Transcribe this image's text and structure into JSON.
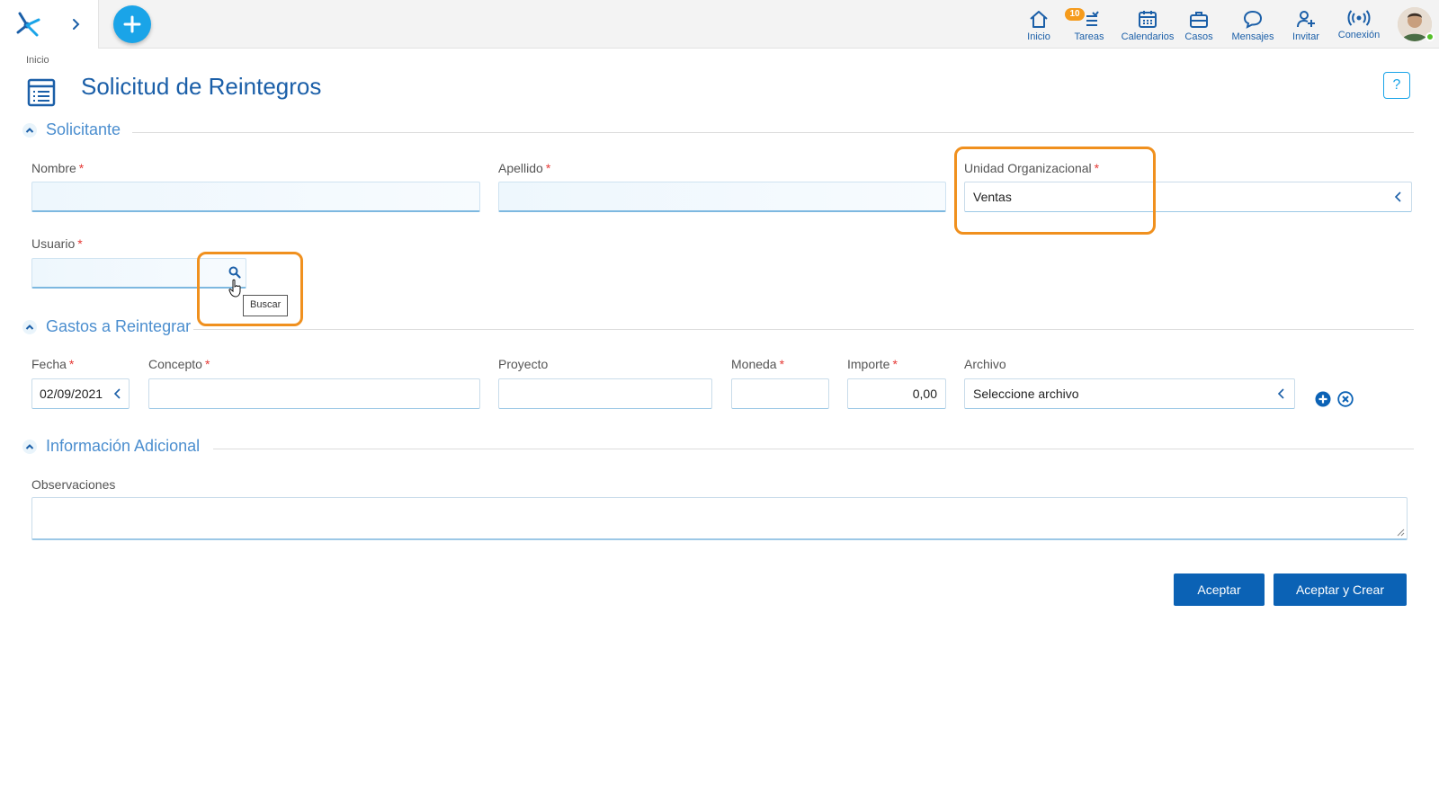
{
  "topbar": {
    "nav": [
      {
        "label": "Inicio",
        "icon": "home-icon"
      },
      {
        "label": "Tareas",
        "icon": "tasks-icon",
        "badge": "10"
      },
      {
        "label": "Calendarios",
        "icon": "calendar-icon"
      },
      {
        "label": "Casos",
        "icon": "briefcase-icon"
      },
      {
        "label": "Mensajes",
        "icon": "chat-icon"
      },
      {
        "label": "Invitar",
        "icon": "invite-icon"
      },
      {
        "label": "Conexión",
        "icon": "connection-icon"
      }
    ]
  },
  "page": {
    "breadcrumb": "Inicio",
    "title": "Solicitud de Reintegros",
    "help": "?"
  },
  "sections": {
    "solicitante": {
      "title": "Solicitante",
      "nombre_label": "Nombre",
      "nombre_value": "",
      "apellido_label": "Apellido",
      "apellido_value": "",
      "unidad_label": "Unidad Organizacional",
      "unidad_value": "Ventas",
      "usuario_label": "Usuario",
      "usuario_value": "",
      "tooltip": "Buscar"
    },
    "gastos": {
      "title": "Gastos a Reintegrar",
      "fecha_label": "Fecha",
      "fecha_value": "02/09/2021",
      "concepto_label": "Concepto",
      "proyecto_label": "Proyecto",
      "moneda_label": "Moneda",
      "importe_label": "Importe",
      "importe_value": "0,00",
      "archivo_label": "Archivo",
      "archivo_value": "Seleccione archivo"
    },
    "adicional": {
      "title": "Información Adicional",
      "observaciones_label": "Observaciones"
    }
  },
  "required_mark": "*",
  "buttons": {
    "aceptar": "Aceptar",
    "aceptar_crear": "Aceptar y Crear"
  },
  "colors": {
    "primary": "#1b5fa8",
    "accent": "#1aa4e8",
    "highlight": "#f0901e",
    "button": "#0b62b5",
    "badge": "#f59b1c"
  }
}
